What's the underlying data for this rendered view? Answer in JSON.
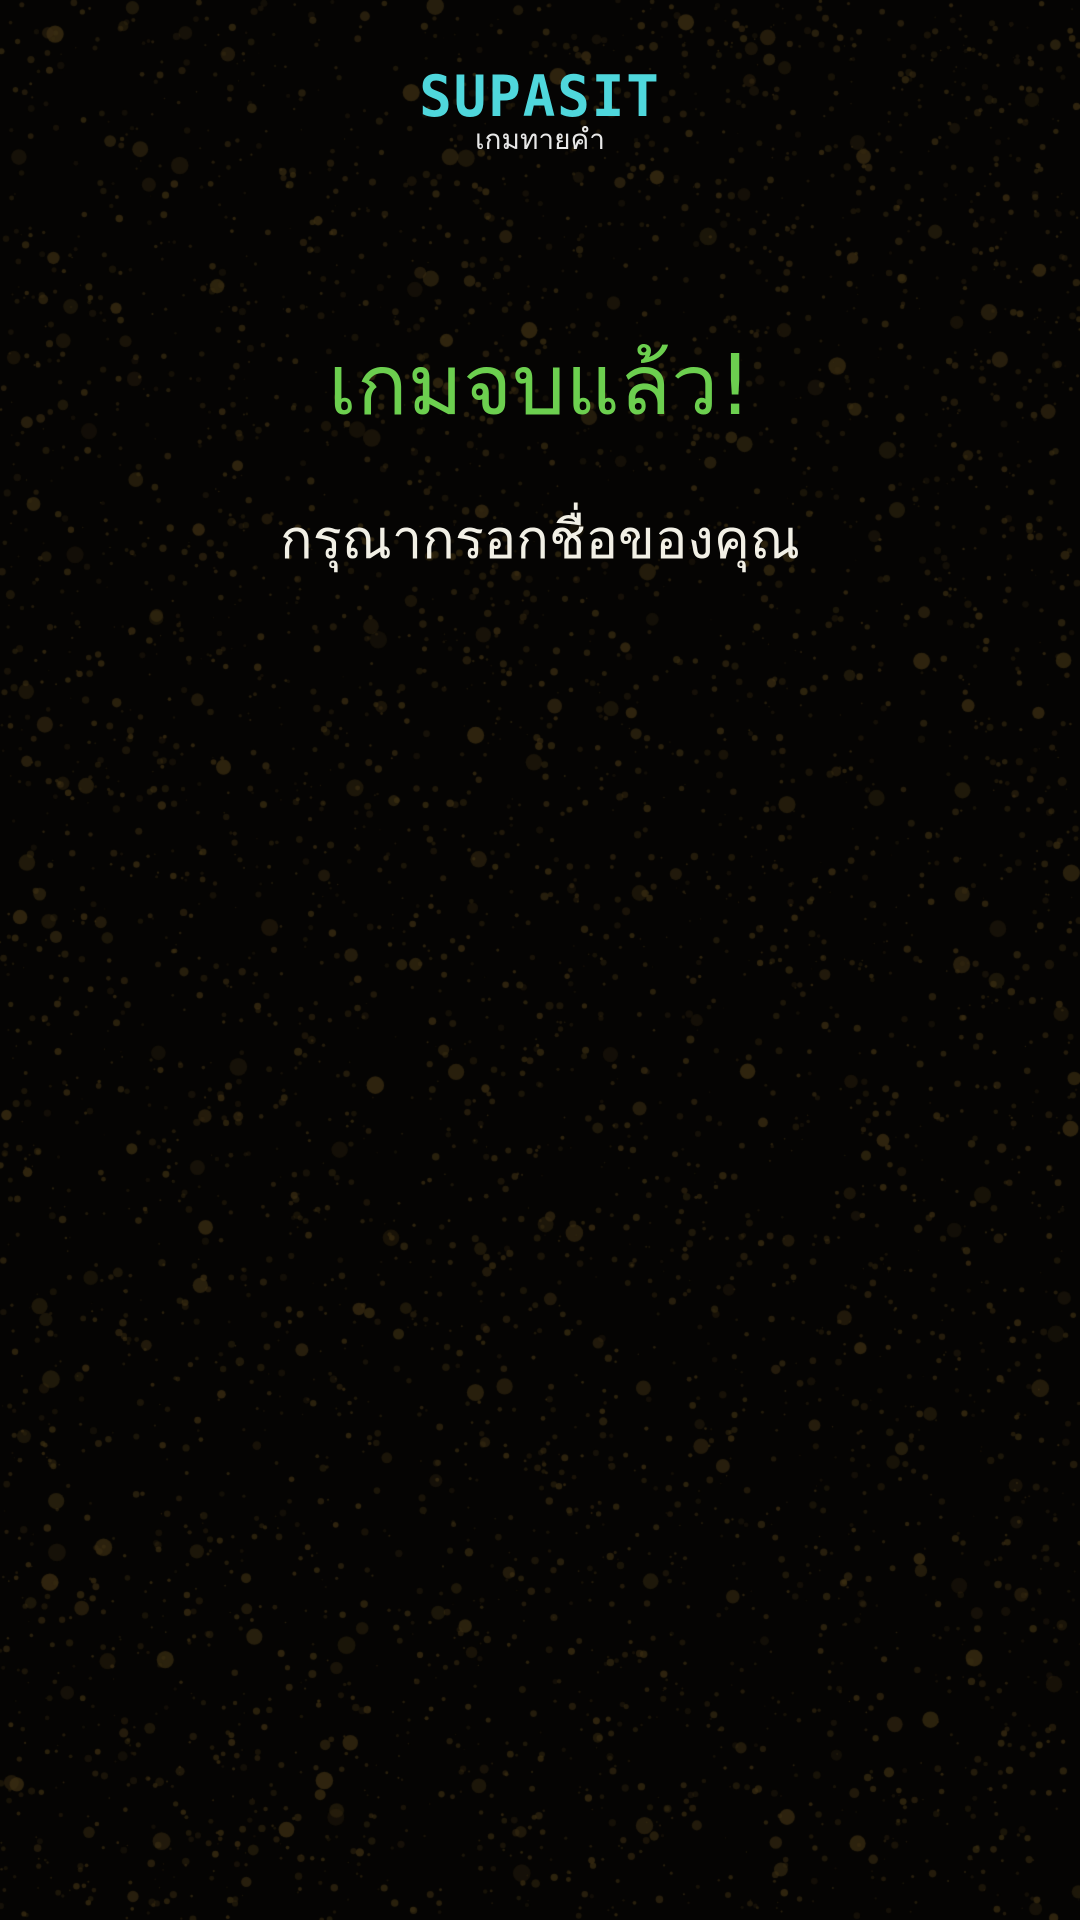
{
  "logo": {
    "brand": "SUPASIT",
    "subtitle": "เกมทายคำ"
  },
  "game_over": {
    "title": "เกมจบแล้ว!",
    "prompt": "กรุณากรอกชื่อของคุณ"
  },
  "colors": {
    "background": "#050403",
    "speckle": "#3a2d12",
    "brand": "#4fd7dc",
    "subtitle": "#e8e8e8",
    "title": "#6ccf4f",
    "prompt": "#f2f0e6"
  }
}
